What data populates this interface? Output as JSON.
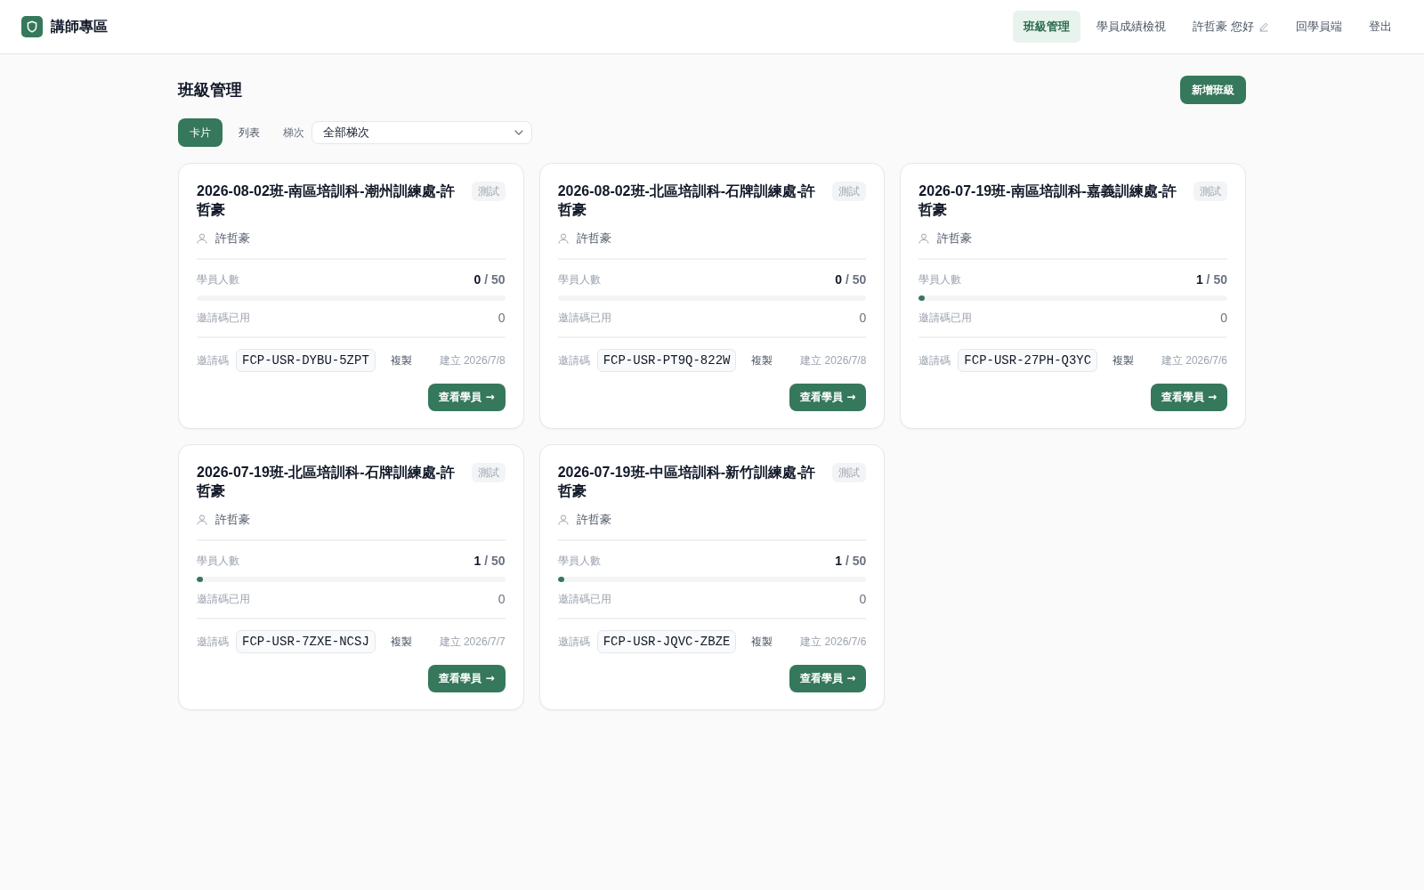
{
  "header": {
    "brand": "講師專區",
    "nav": [
      {
        "label": "班級管理",
        "selected": true,
        "kind": "link"
      },
      {
        "label": "學員成績檢視",
        "selected": false,
        "kind": "link"
      },
      {
        "label": "許哲豪 您好",
        "selected": false,
        "kind": "profile"
      },
      {
        "label": "回學員端",
        "selected": false,
        "kind": "link"
      },
      {
        "label": "登出",
        "selected": false,
        "kind": "link"
      }
    ]
  },
  "page": {
    "title": "班級管理",
    "add_button": "新增班級"
  },
  "view_toggle": [
    {
      "label": "卡片",
      "selected": true
    },
    {
      "label": "列表",
      "selected": false
    }
  ],
  "batch_filter": {
    "label": "梯次",
    "value": "全部梯次"
  },
  "classes": [
    {
      "title": "2026-08-02班-南區培訓科-潮州訓練處-許哲豪",
      "tag": "測試",
      "instructor": "許哲豪",
      "students_label": "學員人數",
      "students": "**0** / 50",
      "invites_used_label": "邀請碼已用",
      "invites_used": "0",
      "invite_code_label": "邀請碼",
      "invite_code": "FCP-USR-DYBU-5ZPT",
      "copy_button": "複製",
      "created": "建立 2026/7/8",
      "view_button": "查看學員 →"
    },
    {
      "title": "2026-08-02班-北區培訓科-石牌訓練處-許哲豪",
      "tag": "測試",
      "instructor": "許哲豪",
      "students_label": "學員人數",
      "students": "**0** / 50",
      "invites_used_label": "邀請碼已用",
      "invites_used": "0",
      "invite_code_label": "邀請碼",
      "invite_code": "FCP-USR-PT9Q-822W",
      "copy_button": "複製",
      "created": "建立 2026/7/8",
      "view_button": "查看學員 →"
    },
    {
      "title": "2026-07-19班-南區培訓科-嘉義訓練處-許哲豪",
      "tag": "測試",
      "instructor": "許哲豪",
      "students_label": "學員人數",
      "students": "**1** / 50",
      "level": 0.02,
      "invites_used_label": "邀請碼已用",
      "invites_used": "0",
      "invite_code_label": "邀請碼",
      "invite_code": "FCP-USR-27PH-Q3YC",
      "copy_button": "複製",
      "created": "建立 2026/7/6",
      "view_button": "查看學員 →"
    },
    {
      "title": "2026-07-19班-北區培訓科-石牌訓練處-許哲豪",
      "tag": "測試",
      "instructor": "許哲豪",
      "students_label": "學員人數",
      "students": "**1** / 50",
      "level": 0.02,
      "invites_used_label": "邀請碼已用",
      "invites_used": "0",
      "invite_code_label": "邀請碼",
      "invite_code": "FCP-USR-7ZXE-NCSJ",
      "copy_button": "複製",
      "created": "建立 2026/7/7",
      "view_button": "查看學員 →"
    },
    {
      "title": "2026-07-19班-中區培訓科-新竹訓練處-許哲豪",
      "tag": "測試",
      "instructor": "許哲豪",
      "students_label": "學員人數",
      "students": "**1** / 50",
      "level": 0.02,
      "invites_used_label": "邀請碼已用",
      "invites_used": "0",
      "invite_code_label": "邀請碼",
      "invite_code": "FCP-USR-JQVC-ZBZE",
      "copy_button": "複製",
      "created": "建立 2026/7/6",
      "view_button": "查看學員 →"
    }
  ]
}
